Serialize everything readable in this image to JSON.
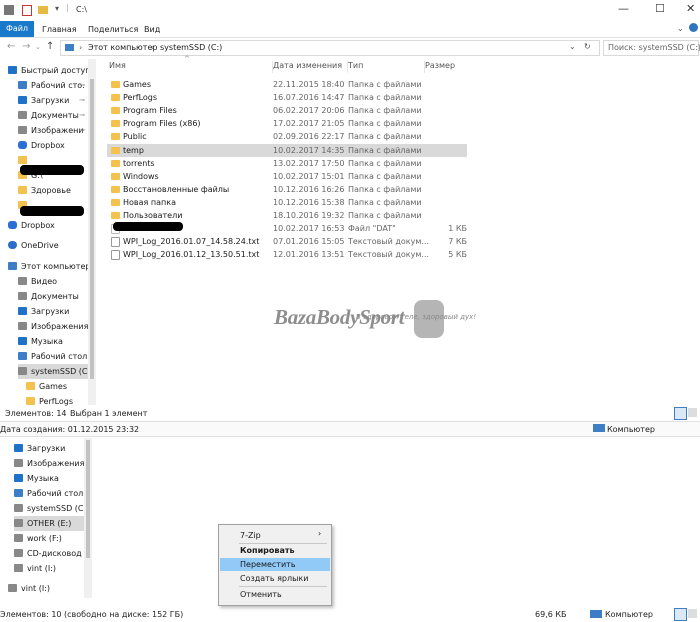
{
  "window": {
    "title": "C:\\",
    "controls": {
      "minimize": "—",
      "maximize": "☐",
      "close": "✕"
    }
  },
  "ribbon": {
    "tabs": [
      "Файл",
      "Главная",
      "Поделиться",
      "Вид"
    ]
  },
  "address": {
    "path": [
      "Этот компьютер",
      "systemSSD (C:)"
    ],
    "search_placeholder": "Поиск: systemSSD (C:)"
  },
  "nav_top": [
    {
      "label": "Быстрый доступ",
      "icon": "star-icon"
    },
    {
      "label": "Рабочий сто.",
      "icon": "desktop-icon"
    },
    {
      "label": "Загрузки",
      "icon": "download-icon"
    },
    {
      "label": "Документы",
      "icon": "documents-icon"
    },
    {
      "label": "Изображени",
      "icon": "pictures-icon"
    },
    {
      "label": "Dropbox",
      "icon": "dropbox-icon"
    },
    {
      "label": "",
      "icon": "folder-icon"
    },
    {
      "label": "G:\\",
      "icon": "folder-icon"
    },
    {
      "label": "Здоровье",
      "icon": "folder-icon"
    },
    {
      "label": "",
      "icon": "folder-icon"
    },
    {
      "label": "Dropbox",
      "icon": "dropbox-icon"
    },
    {
      "label": "OneDrive",
      "icon": "onedrive-icon"
    },
    {
      "label": "Этот компьютер",
      "icon": "computer-icon"
    },
    {
      "label": "Видео",
      "icon": "video-icon"
    },
    {
      "label": "Документы",
      "icon": "documents-icon"
    },
    {
      "label": "Загрузки",
      "icon": "download-icon"
    },
    {
      "label": "Изображения",
      "icon": "pictures-icon"
    },
    {
      "label": "Музыка",
      "icon": "music-icon"
    },
    {
      "label": "Рабочий стол",
      "icon": "desktop-icon"
    },
    {
      "label": "systemSSD (C:)",
      "icon": "drive-icon"
    },
    {
      "label": "Games",
      "icon": "folder-icon"
    },
    {
      "label": "PerfLogs",
      "icon": "folder-icon"
    }
  ],
  "columns": [
    "Имя",
    "Дата изменения",
    "Тип",
    "Размер"
  ],
  "files": [
    {
      "name": "Games",
      "date": "22.11.2015 18:40",
      "type": "Папка с файлами",
      "size": ""
    },
    {
      "name": "PerfLogs",
      "date": "16.07.2016 14:47",
      "type": "Папка с файлами",
      "size": ""
    },
    {
      "name": "Program Files",
      "date": "06.02.2017 20:06",
      "type": "Папка с файлами",
      "size": ""
    },
    {
      "name": "Program Files (x86)",
      "date": "17.02.2017 21:05",
      "type": "Папка с файлами",
      "size": ""
    },
    {
      "name": "Public",
      "date": "02.09.2016 22:17",
      "type": "Папка с файлами",
      "size": ""
    },
    {
      "name": "temp",
      "date": "10.02.2017 14:35",
      "type": "Папка с файлами",
      "size": ""
    },
    {
      "name": "torrents",
      "date": "13.02.2017 17:50",
      "type": "Папка с файлами",
      "size": ""
    },
    {
      "name": "Windows",
      "date": "10.02.2017 15:01",
      "type": "Папка с файлами",
      "size": ""
    },
    {
      "name": "Восстановленные файлы",
      "date": "10.12.2016 16:26",
      "type": "Папка с файлами",
      "size": ""
    },
    {
      "name": "Новая папка",
      "date": "10.12.2016 15:38",
      "type": "Папка с файлами",
      "size": ""
    },
    {
      "name": "Пользователи",
      "date": "18.10.2016 19:32",
      "type": "Папка с файлами",
      "size": ""
    },
    {
      "name": "",
      "date": "10.02.2017 16:53",
      "type": "Файл \"DAT\"",
      "size": "1 КБ"
    },
    {
      "name": "WPI_Log_2016.01.07_14.58.24.txt",
      "date": "07.01.2016 15:05",
      "type": "Текстовый докум...",
      "size": "7 КБ"
    },
    {
      "name": "WPI_Log_2016.01.12_13.50.51.txt",
      "date": "12.01.2016 13:51",
      "type": "Текстовый докум...",
      "size": "5 КБ"
    }
  ],
  "status1": {
    "count": "Элементов: 14",
    "selected": "Выбран 1 элемент"
  },
  "details": {
    "created": "Дата создания: 01.12.2015 23:32",
    "location": "Компьютер"
  },
  "nav_bottom": [
    {
      "label": "Загрузки",
      "icon": "download-icon"
    },
    {
      "label": "Изображения",
      "icon": "pictures-icon"
    },
    {
      "label": "Музыка",
      "icon": "music-icon"
    },
    {
      "label": "Рабочий стол",
      "icon": "desktop-icon"
    },
    {
      "label": "systemSSD (C:)",
      "icon": "drive-icon"
    },
    {
      "label": "OTHER (E:)",
      "icon": "drive-icon"
    },
    {
      "label": "work (F:)",
      "icon": "drive-icon"
    },
    {
      "label": "CD-дисковод (H:",
      "icon": "cd-icon"
    },
    {
      "label": "vint (I:)",
      "icon": "drive-icon"
    },
    {
      "label": "vint (I:)",
      "icon": "drive-icon"
    }
  ],
  "context_menu": [
    "7-Zip",
    "Копировать",
    "Переместить",
    "Создать ярлыки",
    "Отменить"
  ],
  "status2": {
    "count": "Элементов: 10 (свободно на диске: 152 ГБ)",
    "size": "69,6 КБ",
    "location": "Компьютер"
  },
  "watermark": {
    "brand": "BazaBodySport",
    "tagline": "В здоровом теле, здоровый дух!"
  },
  "colors": {
    "accent": "#1979ca",
    "selection": "#d9d9d9",
    "menu_highlight": "#91c9f7"
  }
}
